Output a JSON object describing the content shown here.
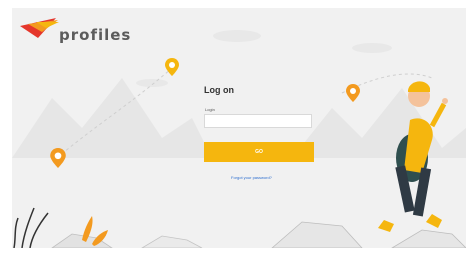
{
  "brand": {
    "name": "profiles",
    "tagline": "",
    "colors": {
      "red": "#e5362b",
      "orange": "#f39a1f",
      "yellow": "#f5b60e",
      "gray": "#5c5c5c"
    }
  },
  "login": {
    "title": "Log on",
    "login_label": "Login",
    "login_value": "",
    "go_label": "GO",
    "forgot_link": "Forgot your password?"
  },
  "icons": [
    "location-pin-icon",
    "hiker-illustration",
    "mountains-illustration",
    "plants-illustration"
  ],
  "theme": {
    "accent": "#f5b60e",
    "link": "#2e6fcf",
    "background": "#f1f1f1"
  }
}
